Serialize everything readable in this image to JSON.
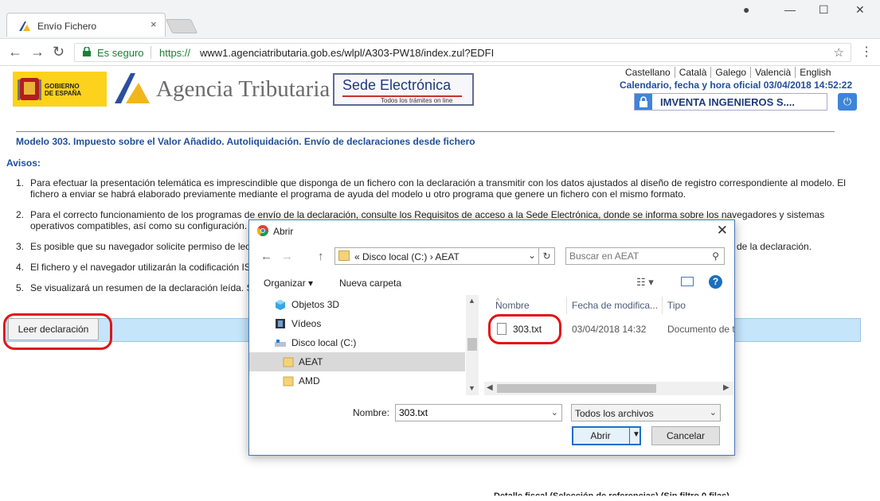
{
  "browser": {
    "tab_title": "Envío Fichero",
    "tab_close": "×",
    "secure_label": "Es seguro",
    "url_scheme": "https://",
    "url_rest": "www1.agenciatributaria.gob.es/wlpl/A303-PW18/index.zul?EDFI",
    "window_controls": {
      "minimize": "—",
      "maximize": "☐",
      "close": "✕",
      "profile": "●"
    },
    "nav": {
      "back": "←",
      "forward": "→",
      "reload": "↻",
      "menu": "⋮",
      "bookmark": "☆"
    }
  },
  "header": {
    "gob_logo_text_line1": "GOBIERNO",
    "gob_logo_text_line2": "DE ESPAÑA",
    "agency_name": "Agencia Tributaria",
    "sede_title": "Sede Electrónica",
    "sede_subtitle": "Todos los trámites on line",
    "languages": [
      "Castellano",
      "Català",
      "Galego",
      "Valencià",
      "English"
    ],
    "calendar": "Calendario, fecha y hora oficial 03/04/2018 14:52:22",
    "user_name": "IMVENTA INGENIEROS S....",
    "logout_icon": "⏻"
  },
  "main": {
    "heading": "Modelo 303. Impuesto sobre el Valor Añadido. Autoliquidación. Envío de declaraciones desde fichero",
    "avisos_title": "Avisos:",
    "avisos": [
      {
        "num": "1.",
        "text": "Para efectuar la presentación telemática es imprescindible que disponga de un fichero con la declaración a transmitir con los datos ajustados al diseño de registro correspondiente al modelo. El fichero a enviar se habrá elaborado previamente mediante el programa de ayuda del modelo u otro programa que genere un fichero con el mismo formato."
      },
      {
        "num": "2.",
        "text": "Para el correcto funcionamiento de los programas de envío de la declaración, consulte los Requisitos de acceso a la Sede Electrónica, donde se informa sobre los navegadores y sistemas operativos compatibles, así como su configuración."
      },
      {
        "num": "3.",
        "text": "Es posible que su navegador solicite permiso de lec"
      },
      {
        "num": "4.",
        "text": "El fichero y el navegador utilizarán la codificación IS"
      },
      {
        "num": "5.",
        "text": "Se visualizará un resumen de la declaración leída. S"
      }
    ],
    "aviso3_tail": "de la declaración.",
    "read_button": "Leer declaración",
    "bottom_cut_text": "Detalle fiscal (Selección de referencias) (Sin filtro 0 filas)"
  },
  "dialog": {
    "title": "Abrir",
    "close": "✕",
    "breadcrumb": "«  Disco local (C:)  ›  AEAT",
    "search_placeholder": "Buscar en AEAT",
    "organize": "Organizar ▾",
    "new_folder": "Nueva carpeta",
    "views_icon": "☷ ▾",
    "help": "?",
    "tree": [
      {
        "label": "Objetos 3D",
        "icon": "cube-icon"
      },
      {
        "label": "Vídeos",
        "icon": "film-icon"
      },
      {
        "label": "Disco local (C:)",
        "icon": "drive-icon"
      },
      {
        "label": "AEAT",
        "icon": "folder-icon",
        "selected": true
      },
      {
        "label": "AMD",
        "icon": "folder-icon"
      }
    ],
    "columns": [
      "Nombre",
      "Fecha de modifica...",
      "Tipo"
    ],
    "file": {
      "name": "303.txt",
      "date": "03/04/2018 14:32",
      "type": "Documento de texto"
    },
    "name_label": "Nombre:",
    "name_value": "303.txt",
    "filter_value": "Todos los archivos",
    "open_button": "Abrir",
    "cancel_button": "Cancelar"
  },
  "colors": {
    "accent": "#1f4e9c",
    "highlight_ring": "#e01515",
    "read_bar": "#c5e5fb"
  }
}
